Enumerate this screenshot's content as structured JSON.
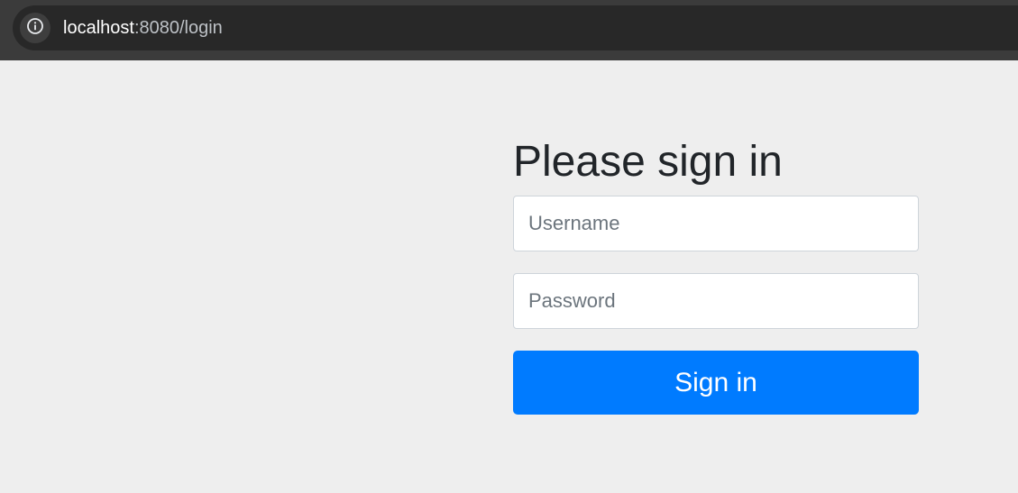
{
  "browser": {
    "url_host": "localhost",
    "url_path": ":8080/login",
    "info_icon": "info-circle-icon"
  },
  "login": {
    "heading": "Please sign in",
    "username_placeholder": "Username",
    "password_placeholder": "Password",
    "submit_label": "Sign in"
  },
  "colors": {
    "page_background": "#eeeeee",
    "button_primary": "#007bff",
    "chrome_background": "#3b3b3b",
    "omnibox_background": "#282828"
  }
}
